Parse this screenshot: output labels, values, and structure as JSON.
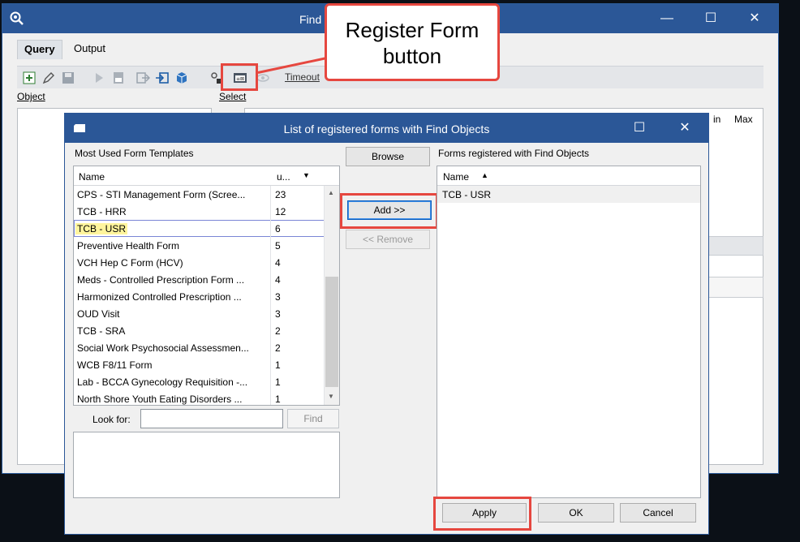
{
  "background_window": {
    "title": "Find",
    "tabs": [
      {
        "label": "Query",
        "active": true
      },
      {
        "label": "Output",
        "active": false
      }
    ],
    "toolbar": {
      "timeout_label": "Timeout"
    },
    "object_label": "Object",
    "select_label": "Select",
    "right_columns": [
      "in",
      "Max"
    ],
    "controls": {
      "minimize": "—",
      "maximize": "☐",
      "close": "✕"
    }
  },
  "callout": {
    "line1": "Register Form",
    "line2": "button",
    "color": "#e6473f"
  },
  "dialog": {
    "title": "List of registered forms with Find Objects",
    "controls": {
      "maximize": "☐",
      "close": "✕"
    },
    "left": {
      "header": "Most Used Form Templates",
      "columns": {
        "name": "Name",
        "count": "u..."
      },
      "rows": [
        {
          "name": "CPS - STI Management Form (Scree...",
          "count": "23"
        },
        {
          "name": "TCB - HRR",
          "count": "12"
        },
        {
          "name": "TCB - USR",
          "count": "6",
          "selected": true
        },
        {
          "name": "Preventive Health Form",
          "count": "5"
        },
        {
          "name": "VCH Hep C Form (HCV)",
          "count": "4"
        },
        {
          "name": "Meds - Controlled Prescription Form ...",
          "count": "4"
        },
        {
          "name": "Harmonized Controlled Prescription ...",
          "count": "3"
        },
        {
          "name": "OUD Visit",
          "count": "3"
        },
        {
          "name": "TCB - SRA",
          "count": "2"
        },
        {
          "name": "Social Work Psychosocial Assessmen...",
          "count": "2"
        },
        {
          "name": "WCB F8/11 Form",
          "count": "1"
        },
        {
          "name": "Lab - BCCA Gynecology Requisition -...",
          "count": "1"
        },
        {
          "name": "North Shore Youth Eating Disorders ...",
          "count": "1"
        }
      ],
      "look_for_label": "Look for:",
      "look_for_value": "",
      "find_label": "Find"
    },
    "middle": {
      "browse_label": "Browse",
      "add_label": "Add >>",
      "remove_label": "<< Remove"
    },
    "right": {
      "header": "Forms registered with Find Objects",
      "column_name": "Name",
      "rows": [
        {
          "name": "TCB - USR"
        }
      ]
    },
    "buttons": {
      "apply": "Apply",
      "ok": "OK",
      "cancel": "Cancel"
    }
  },
  "colors": {
    "titlebar": "#2b5797",
    "highlight_red": "#e6473f",
    "selected_row_bg": "#fff59d"
  }
}
